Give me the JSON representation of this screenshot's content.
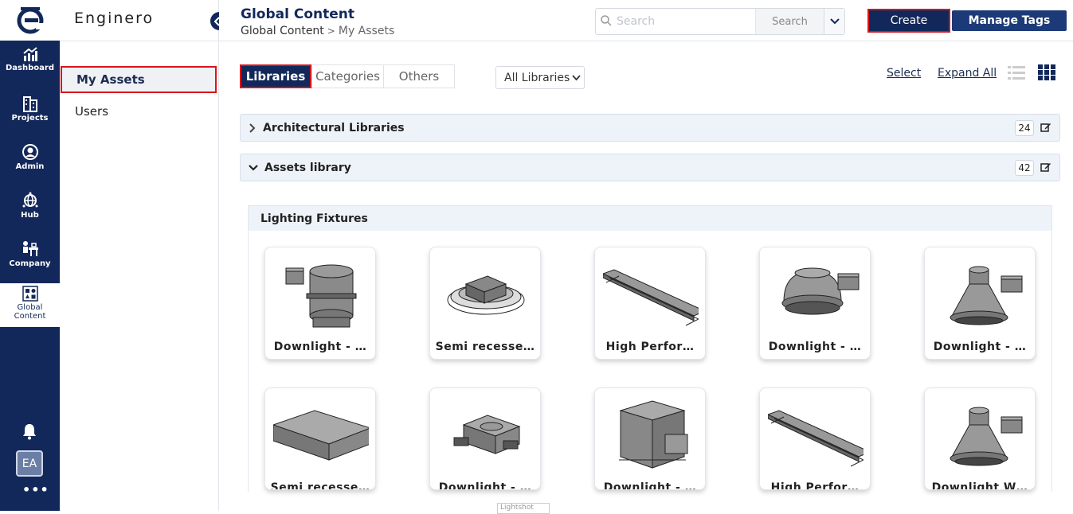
{
  "rail": {
    "items": [
      {
        "label": "Dashboard",
        "icon": "chart-up-icon"
      },
      {
        "label": "Projects",
        "icon": "buildings-icon"
      },
      {
        "label": "Admin",
        "icon": "user-circle-icon"
      },
      {
        "label": "Hub",
        "icon": "globe-hub-icon"
      },
      {
        "label": "Company",
        "icon": "company-icon"
      },
      {
        "label": "Global Content",
        "icon": "grid-shapes-icon"
      }
    ],
    "avatar": "EA",
    "more": "•••"
  },
  "sidebar": {
    "brand": "Enginero",
    "items": [
      {
        "label": "My Assets"
      },
      {
        "label": "Users"
      }
    ]
  },
  "header": {
    "title": "Global Content",
    "breadcrumb": [
      "Global Content",
      "My Assets"
    ],
    "breadcrumb_sep": ">",
    "search_placeholder": "Search",
    "search_button": "Search",
    "create": "Create",
    "manage_tags": "Manage Tags"
  },
  "toolbar": {
    "tabs": [
      "Libraries",
      "Categories",
      "Others"
    ],
    "filter": "All Libraries",
    "select": "Select",
    "expand_all": "Expand All"
  },
  "libraries": [
    {
      "name": "Architectural Libraries",
      "count": "24",
      "expanded": false
    },
    {
      "name": "Assets library",
      "count": "42",
      "expanded": true
    }
  ],
  "category": {
    "name": "Lighting Fixtures",
    "cards": [
      {
        "label": "Downlight - …",
        "thumb": "cylinder-box"
      },
      {
        "label": "Semi recesse…",
        "thumb": "round-plate"
      },
      {
        "label": "High Perfor…",
        "thumb": "linear"
      },
      {
        "label": "Downlight - …",
        "thumb": "dome-box"
      },
      {
        "label": "Downlight - …",
        "thumb": "cone-box"
      },
      {
        "label": "Semi recesse…",
        "thumb": "square-panel"
      },
      {
        "label": "Downlight - …",
        "thumb": "square-clip"
      },
      {
        "label": "Downlight - …",
        "thumb": "cube-box"
      },
      {
        "label": "High Perfor…",
        "thumb": "linear"
      },
      {
        "label": "Downlight W…",
        "thumb": "cone-box"
      }
    ]
  },
  "overlay": {
    "lightshot": "Lightshot"
  },
  "colors": {
    "navy": "#13285a",
    "highlight": "#d8141c",
    "row_bg": "#eef3fa"
  }
}
